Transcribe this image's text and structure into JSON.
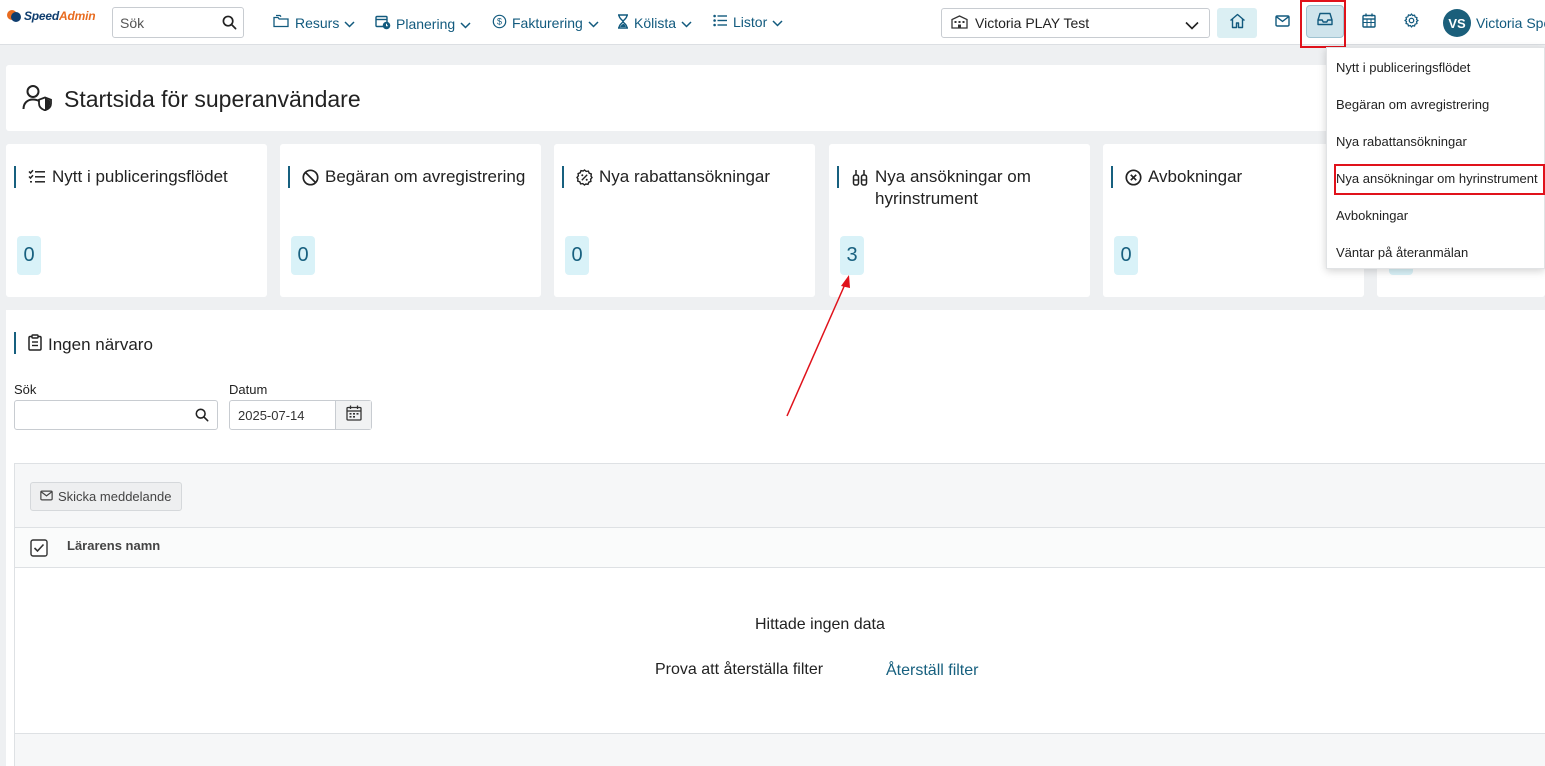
{
  "app": {
    "logo_speed": "Speed",
    "logo_admin": "Admin",
    "search_placeholder": "Sök"
  },
  "nav": [
    {
      "label": "Resurs",
      "icon": "folders-icon"
    },
    {
      "label": "Planering",
      "icon": "calendar-clock-icon"
    },
    {
      "label": "Fakturering",
      "icon": "dollar-circle-icon"
    },
    {
      "label": "Kölista",
      "icon": "hourglass-icon"
    },
    {
      "label": "Listor",
      "icon": "list-icon"
    }
  ],
  "org_select": {
    "value": "Victoria PLAY Test"
  },
  "user": {
    "initials": "VS",
    "name": "Victoria Spe"
  },
  "page": {
    "title": "Startsida för superanvändare"
  },
  "cards": [
    {
      "title": "Nytt i publiceringsflödet",
      "count": "0"
    },
    {
      "title": "Begäran om avregistrering",
      "count": "0"
    },
    {
      "title": "Nya rabattansökningar",
      "count": "0"
    },
    {
      "title": "Nya ansökningar om hyrinstrument",
      "count": "3"
    },
    {
      "title": "Avbokningar",
      "count": "0"
    }
  ],
  "attendance": {
    "title": "Ingen närvaro",
    "search_label": "Sök",
    "search_value": "",
    "date_label": "Datum",
    "date_value": "2025-07-14",
    "send_button": "Skicka meddelande",
    "column_teacher": "Lärarens namn",
    "empty_title": "Hittade ingen data",
    "empty_hint": "Prova att återställa filter",
    "reset_link": "Återställ filter"
  },
  "dropdown": {
    "items": [
      "Nytt i publiceringsflödet",
      "Begäran om avregistrering",
      "Nya rabattansökningar",
      "Nya ansökningar om hyrinstrument",
      "Avbokningar",
      "Väntar på återanmälan"
    ]
  },
  "colors": {
    "primary": "#17607f",
    "badge_bg": "#d9f2f8",
    "highlight": "#e0121b",
    "logo_orange": "#e86b1f"
  }
}
